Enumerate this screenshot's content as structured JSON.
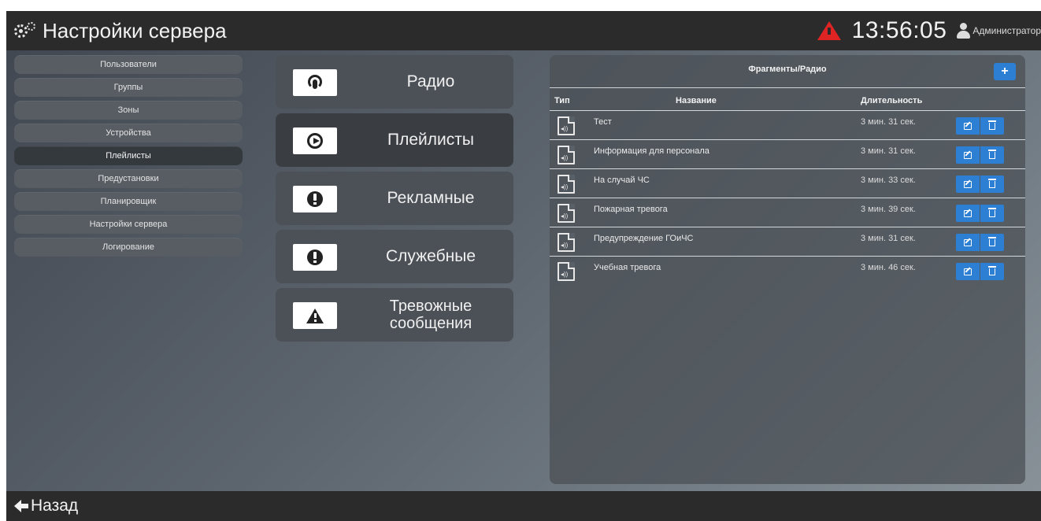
{
  "header": {
    "title": "Настройки сервера",
    "clock": "13:56:05",
    "user": "Администратор",
    "icons": {
      "app": "gears-icon",
      "alert": "alert-triangle-icon",
      "user": "user-icon"
    }
  },
  "sidebar": {
    "items": [
      {
        "label": "Пользователи"
      },
      {
        "label": "Группы"
      },
      {
        "label": "Зоны"
      },
      {
        "label": "Устройства"
      },
      {
        "label": "Плейлисты",
        "active": true
      },
      {
        "label": "Предустановки"
      },
      {
        "label": "Планировщик"
      },
      {
        "label": "Настройки сервера"
      },
      {
        "label": "Логирование"
      }
    ]
  },
  "categories": [
    {
      "label": "Радио",
      "icon": "podcast-icon"
    },
    {
      "label": "Плейлисты",
      "icon": "play-circle-icon",
      "active": true
    },
    {
      "label": "Рекламные",
      "icon": "exclamation-circle-icon"
    },
    {
      "label": "Служебные",
      "icon": "exclamation-circle-icon"
    },
    {
      "label_line1": "Тревожные",
      "label_line2": "сообщения",
      "icon": "warning-triangle-icon"
    }
  ],
  "panel": {
    "title": "Фрагменты/Радио",
    "add_label": "+",
    "columns": {
      "type": "Тип",
      "name": "Название",
      "duration": "Длительность"
    },
    "rows": [
      {
        "name": "Тест",
        "duration": "3 мин. 31 сек."
      },
      {
        "name": "Информация для персонала",
        "duration": "3 мин. 31 сек."
      },
      {
        "name": "На случай ЧС",
        "duration": "3 мин. 33 сек."
      },
      {
        "name": "Пожарная тревога",
        "duration": "3 мин. 39 сек."
      },
      {
        "name": "Предупреждение ГОиЧС",
        "duration": "3 мин. 31 сек."
      },
      {
        "name": "Учебная тревога",
        "duration": "3 мин. 46 сек."
      }
    ]
  },
  "footer": {
    "back_label": "Назад"
  },
  "colors": {
    "accent": "#2d7fd3",
    "alert": "#e02424",
    "bar": "#2b2b2b"
  }
}
